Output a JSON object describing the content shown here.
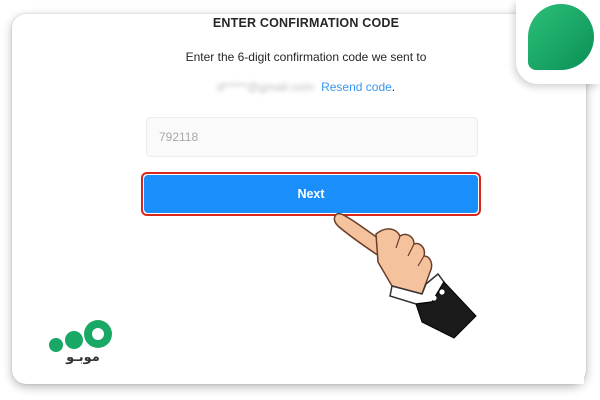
{
  "screen": {
    "title": "ENTER CONFIRMATION CODE",
    "instruction": "Enter the 6-digit confirmation code we sent to",
    "email_masked": "d*****@gmail.com",
    "resend_label": "Resend code",
    "period": "."
  },
  "form": {
    "code_value": "792118",
    "next_label": "Next"
  },
  "brand": {
    "text": "موبـو",
    "logo_color": "#1aa866",
    "dark_color": "#333333"
  },
  "colors": {
    "next_button": "#1a8ffb",
    "highlight_border": "#d9261c",
    "link": "#3897f0"
  },
  "icons": [
    "pointing-hand-icon",
    "brand-badge-icon",
    "brand-logo-icon"
  ]
}
